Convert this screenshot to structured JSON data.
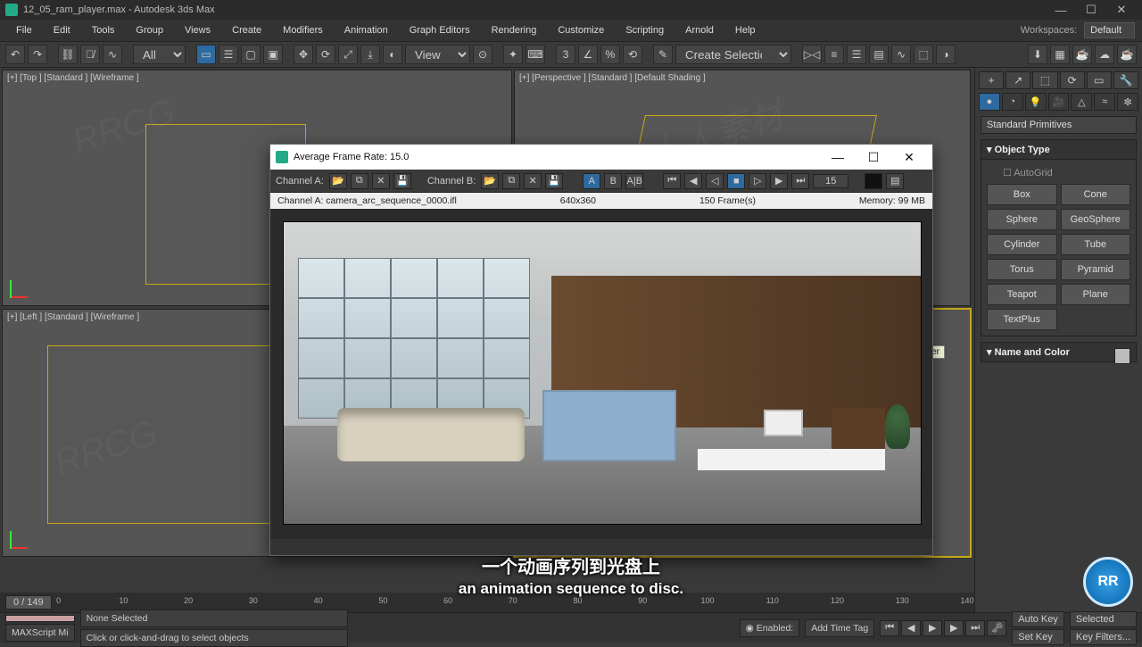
{
  "window": {
    "title": "12_05_ram_player.max - Autodesk 3ds Max",
    "min": "—",
    "max": "☐",
    "close": "✕"
  },
  "menubar": {
    "items": [
      "File",
      "Edit",
      "Tools",
      "Group",
      "Views",
      "Create",
      "Modifiers",
      "Animation",
      "Graph Editors",
      "Rendering",
      "Customize",
      "Scripting",
      "Arnold",
      "Help"
    ],
    "workspaces_label": "Workspaces:",
    "workspaces_value": "Default"
  },
  "toolbar": {
    "filter_label": "All",
    "view_label": "View",
    "selset_label": "Create Selection Se"
  },
  "viewports": {
    "tl": "[+] [Top ] [Standard ] [Wireframe ]",
    "tr": "[+] [Perspective ] [Standard ] [Default Shading ]",
    "bl": "[+] [Left ] [Standard ] [Wireframe ]",
    "tooltip": "light blocker"
  },
  "ram_player": {
    "title": "Average Frame Rate: 15.0",
    "channelA": "Channel A:",
    "channelB": "Channel B:",
    "A": "A",
    "B": "B",
    "fps": "15",
    "status_file": "Channel A: camera_arc_sequence_0000.ifl",
    "status_res": "640x360",
    "status_frames": "150 Frame(s)",
    "status_mem": "Memory: 99 MB"
  },
  "cmd": {
    "dropdown": "Standard Primitives",
    "object_type": "Object Type",
    "autogrid": "AutoGrid",
    "buttons": [
      "Box",
      "Cone",
      "Sphere",
      "GeoSphere",
      "Cylinder",
      "Tube",
      "Torus",
      "Pyramid",
      "Teapot",
      "Plane",
      "TextPlus",
      ""
    ],
    "name_color": "Name and Color"
  },
  "timeline": {
    "slider": "0 / 149",
    "ticks": [
      "0",
      "10",
      "20",
      "30",
      "40",
      "50",
      "60",
      "70",
      "80",
      "90",
      "100",
      "110",
      "120",
      "130",
      "140"
    ]
  },
  "status": {
    "maxscript": "MAXScript Mi",
    "none_selected": "None Selected",
    "hint": "Click or click-and-drag to select objects",
    "enabled": "Enabled:",
    "add_time_tag": "Add Time Tag",
    "autokey": "Auto Key",
    "setkey": "Set Key",
    "selected": "Selected",
    "keyfilters": "Key Filters..."
  },
  "subtitle": {
    "zh": "一个动画序列到光盘上",
    "en": "an animation sequence to disc."
  },
  "badge": "RR"
}
